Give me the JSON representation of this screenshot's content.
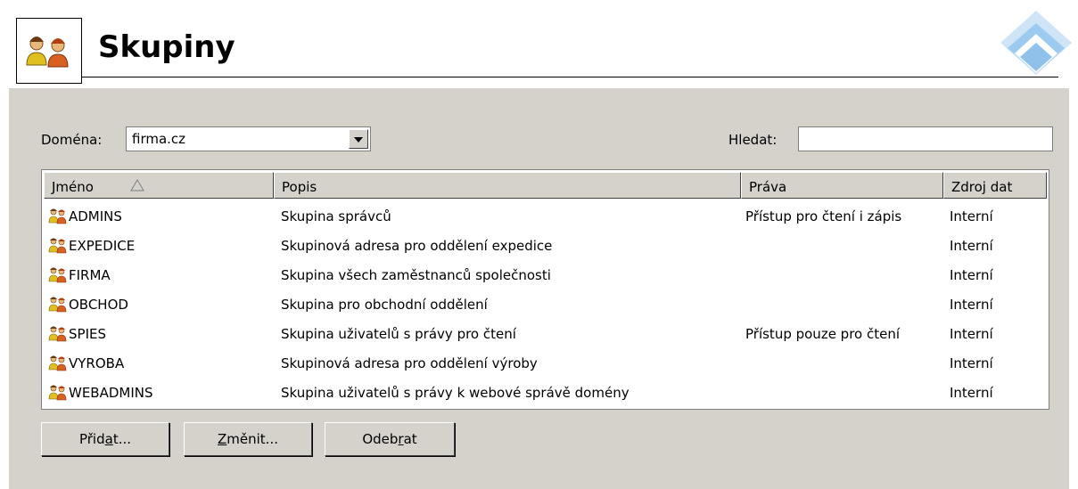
{
  "page": {
    "title": "Skupiny",
    "icon": "group-icon"
  },
  "filter": {
    "domain_label": "Doména:",
    "domain_value": "firma.cz",
    "search_label": "Hledat:",
    "search_value": ""
  },
  "table": {
    "columns": [
      "Jméno",
      "Popis",
      "Práva",
      "Zdroj dat"
    ],
    "sorted_column": "Jméno",
    "sort_direction": "ascending",
    "rows": [
      {
        "name": "ADMINS",
        "desc": "Skupina správců",
        "rights": "Přístup pro čtení i zápis",
        "source": "Interní"
      },
      {
        "name": "EXPEDICE",
        "desc": "Skupinová adresa pro oddělení expedice",
        "rights": "",
        "source": "Interní"
      },
      {
        "name": "FIRMA",
        "desc": "Skupina všech zaměstnanců společnosti",
        "rights": "",
        "source": "Interní"
      },
      {
        "name": "OBCHOD",
        "desc": "Skupina pro obchodní oddělení",
        "rights": "",
        "source": "Interní"
      },
      {
        "name": "SPIES",
        "desc": "Skupina uživatelů s právy pro čtení",
        "rights": "Přístup pouze pro čtení",
        "source": "Interní"
      },
      {
        "name": "VYROBA",
        "desc": "Skupinová adresa pro oddělení výroby",
        "rights": "",
        "source": "Interní"
      },
      {
        "name": "WEBADMINS",
        "desc": "Skupina uživatelů s právy k webové správě domény",
        "rights": "",
        "source": "Interní"
      }
    ]
  },
  "buttons": {
    "add": {
      "pre": "Přid",
      "accel": "a",
      "post": "t..."
    },
    "edit": {
      "pre": "",
      "accel": "Z",
      "post": "měnit..."
    },
    "remove": {
      "pre": "Odeb",
      "accel": "r",
      "post": "at"
    }
  },
  "colors": {
    "panel": "#d5d1cb",
    "logo_blue": "#8fc1ea"
  }
}
